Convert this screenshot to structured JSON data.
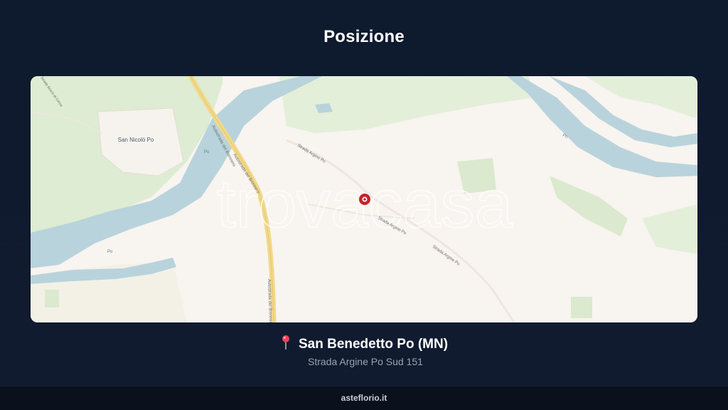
{
  "page": {
    "title": "Posizione"
  },
  "map": {
    "labels": {
      "town": "San Nicolò Po",
      "highway_1": "Autostrada del Brennero",
      "highway_2": "Autostrada del Brennero",
      "highway_3": "Autostrada del Brennero",
      "road_1": "Strada Argine Po",
      "road_2": "Strada Argine Po",
      "road_3": "Strada Argine Po",
      "river_1": "Po",
      "river_2": "Po",
      "river_3": "Po",
      "corner_top_left": "Strada Bosco di Cerca"
    },
    "watermark": "trovacasa",
    "marker_icon": "map-marker-icon",
    "colors": {
      "land": "#f8f4ef",
      "water": "#b9d3dc",
      "green": "#ddecd2",
      "highway": "#f1d98a",
      "marker": "#c4232e"
    }
  },
  "location": {
    "icon": "pushpin-icon",
    "name": "San Benedetto Po (MN)",
    "address": "Strada Argine Po Sud 151"
  },
  "footer": {
    "brand": "asteflorio.it"
  }
}
